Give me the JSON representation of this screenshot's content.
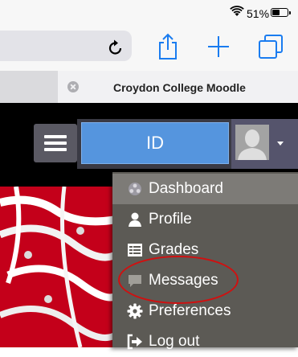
{
  "status_bar": {
    "battery_text": "51%",
    "battery_level": 0.51
  },
  "browser": {
    "tab_title": "Croydon College Moodle",
    "icons": [
      "reload-icon",
      "share-icon",
      "plus-icon",
      "tabs-icon",
      "close-tab-icon"
    ]
  },
  "navbar": {
    "id_field_value": "ID"
  },
  "menu": {
    "items": [
      {
        "label": "Dashboard",
        "icon": "dashboard-icon"
      },
      {
        "label": "Profile",
        "icon": "person-icon"
      },
      {
        "label": "Grades",
        "icon": "grades-icon"
      },
      {
        "label": "Messages",
        "icon": "message-icon"
      },
      {
        "label": "Preferences",
        "icon": "gear-icon"
      },
      {
        "label": "Log out",
        "icon": "logout-icon"
      }
    ]
  },
  "colors": {
    "id_field": "#5595de",
    "menu_bg": "#5c5a55",
    "menu_highlight": "#7d7b77",
    "annotation_ring": "#d01010"
  }
}
